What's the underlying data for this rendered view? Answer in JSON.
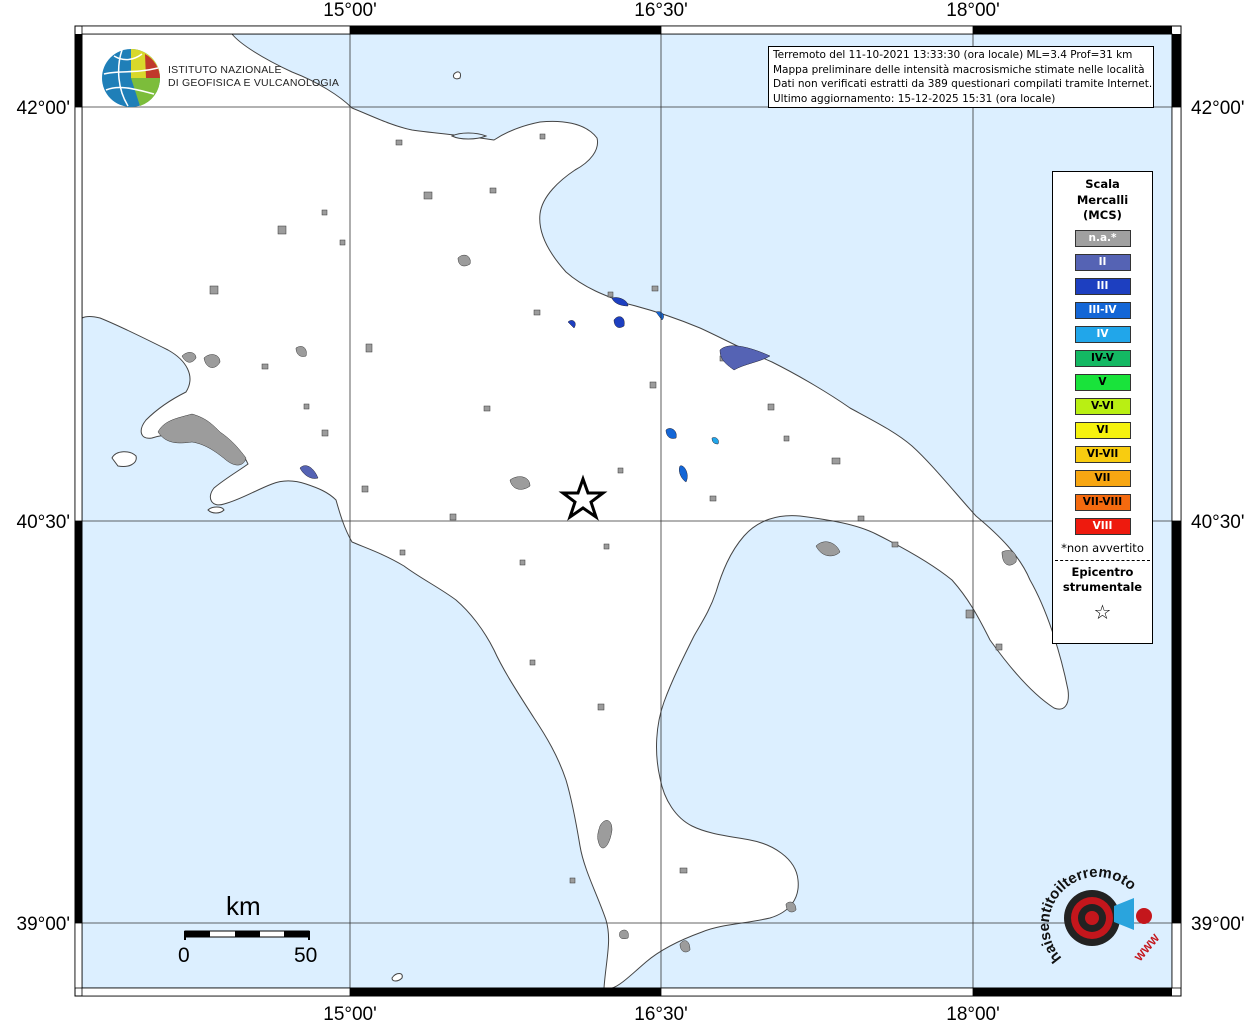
{
  "lon_ticks": [
    "15°00'",
    "16°30'",
    "18°00'"
  ],
  "lat_ticks": [
    "42°00'",
    "40°30'",
    "39°00'"
  ],
  "info": {
    "line1": "Terremoto del 11-10-2021 13:33:30 (ora locale) ML=3.4 Prof=31 km",
    "line2": "Mappa preliminare delle intensità macrosismiche stimate nelle località",
    "line3": "Dati non verificati estratti da 389 questionari compilati tramite Internet.",
    "line4": "Ultimo aggiornamento: 15-12-2025 15:31 (ora locale)"
  },
  "logo": {
    "line1": "ISTITUTO NAZIONALE",
    "line2": "DI GEOFISICA E VULCANOLOGIA",
    "hsit_text": "haisentitoilterremoto.it",
    "hsit_url": "WWW"
  },
  "legend": {
    "title1": "Scala",
    "title2": "Mercalli",
    "title3": "(MCS)",
    "items": [
      {
        "label": "n.a.*",
        "color": "#a0a0a0",
        "dark": false
      },
      {
        "label": "II",
        "color": "#5563b4",
        "dark": false
      },
      {
        "label": "III",
        "color": "#1d3fc0",
        "dark": false
      },
      {
        "label": "III-IV",
        "color": "#1466d6",
        "dark": false
      },
      {
        "label": "IV",
        "color": "#21a6ea",
        "dark": false
      },
      {
        "label": "IV-V",
        "color": "#14b863",
        "dark": true
      },
      {
        "label": "V",
        "color": "#19e33b",
        "dark": true
      },
      {
        "label": "V-VI",
        "color": "#b9ef13",
        "dark": true
      },
      {
        "label": "VI",
        "color": "#f5f20e",
        "dark": true
      },
      {
        "label": "VI-VII",
        "color": "#f8cc10",
        "dark": true
      },
      {
        "label": "VII",
        "color": "#f7a612",
        "dark": true
      },
      {
        "label": "VII-VIII",
        "color": "#f46a0f",
        "dark": true
      },
      {
        "label": "VIII",
        "color": "#ee1a0e",
        "dark": false
      }
    ],
    "note": "*non avvertito",
    "epi1": "Epicentro",
    "epi2": "strumentale",
    "star": "☆"
  },
  "scale": {
    "unit": "km",
    "min": "0",
    "max": "50"
  },
  "colors": {
    "sea": "#dcefff",
    "land": "#ffffff",
    "grey_place": "#9c9c9c",
    "blue_place": "#1d3fc0"
  }
}
